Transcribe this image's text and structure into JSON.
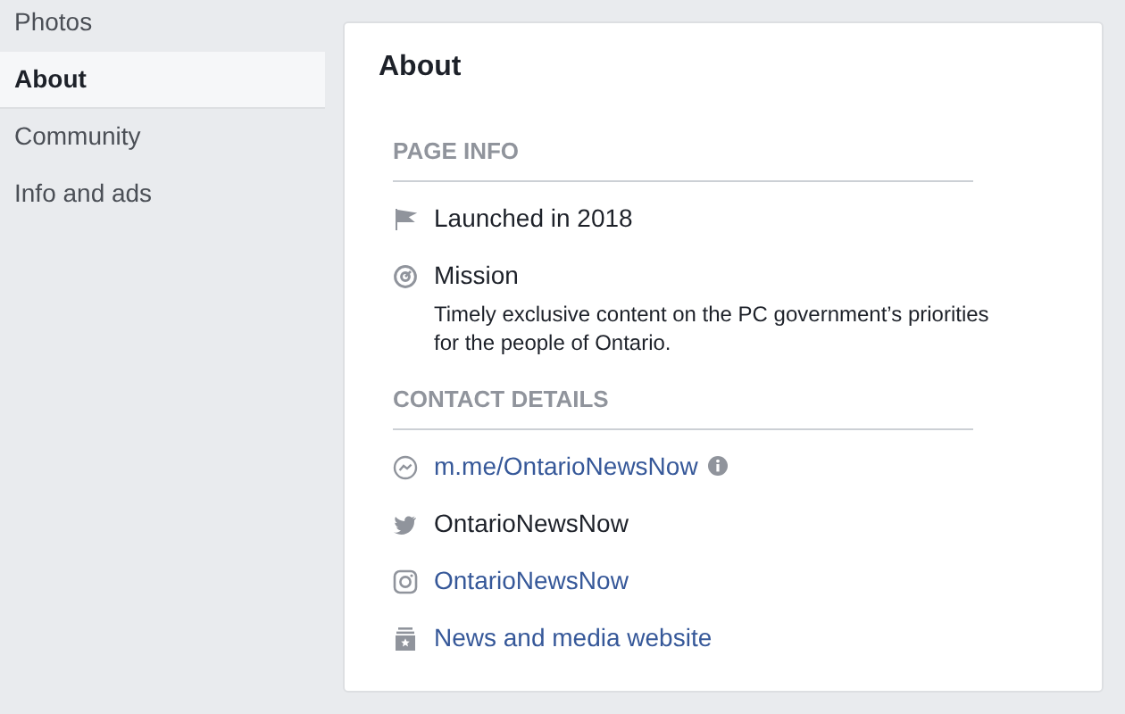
{
  "sidebar": {
    "items": [
      {
        "label": "Photos",
        "selected": false
      },
      {
        "label": "About",
        "selected": true
      },
      {
        "label": "Community",
        "selected": false
      },
      {
        "label": "Info and ads",
        "selected": false
      }
    ]
  },
  "card": {
    "title": "About",
    "sections": [
      {
        "heading": "PAGE INFO",
        "items": [
          {
            "kind": "flag",
            "text": "Launched in 2018",
            "link": false
          },
          {
            "kind": "mission",
            "text": "Mission",
            "link": false,
            "detail": "Timely exclusive content on the PC government’s priorities for the people of Ontario."
          }
        ]
      },
      {
        "heading": "CONTACT DETAILS",
        "items": [
          {
            "kind": "messenger",
            "text": "m.me/OntarioNewsNow",
            "link": true,
            "info": true
          },
          {
            "kind": "bird",
            "text": "OntarioNewsNow",
            "link": false
          },
          {
            "kind": "instagram",
            "text": "OntarioNewsNow",
            "link": true
          },
          {
            "kind": "category",
            "text": "News and media website",
            "link": true
          }
        ]
      }
    ]
  }
}
